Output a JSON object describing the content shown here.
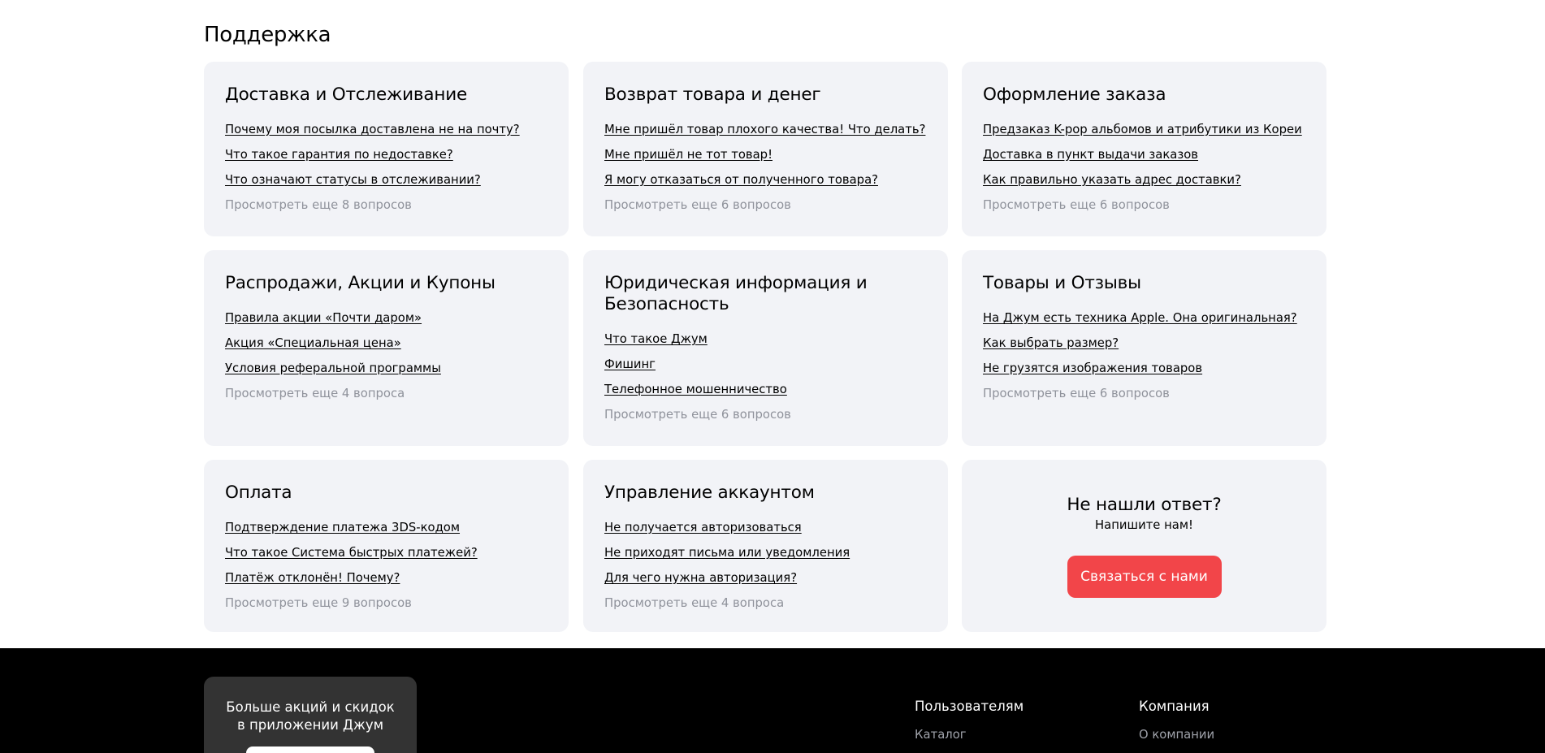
{
  "support": {
    "title": "Поддержка",
    "cards": [
      {
        "title": "Доставка и Отслеживание",
        "links": [
          "Почему моя посылка доставлена не на почту?",
          "Что такое гарантия по недоставке?",
          "Что означают статусы в отслеживании?"
        ],
        "more": "Просмотреть еще 8 вопросов"
      },
      {
        "title": "Возврат товара и денег",
        "links": [
          "Мне пришёл товар плохого качества! Что делать?",
          "Мне пришёл не тот товар!",
          "Я могу отказаться от полученного товара?"
        ],
        "more": "Просмотреть еще 6 вопросов"
      },
      {
        "title": "Оформление заказа",
        "links": [
          "Предзаказ K-pop альбомов и атрибутики из Кореи",
          "Доставка в пункт выдачи заказов",
          "Как правильно указать адрес доставки?"
        ],
        "more": "Просмотреть еще 6 вопросов"
      },
      {
        "title": "Распродажи, Акции и Купоны",
        "links": [
          "Правила акции «Почти даром»",
          "Акция «Специальная цена»",
          "Условия реферальной программы"
        ],
        "more": "Просмотреть еще 4 вопроса"
      },
      {
        "title": "Юридическая информация и Безопасность",
        "links": [
          "Что такое Джум",
          "Фишинг",
          "Телефонное мошенничество"
        ],
        "more": "Просмотреть еще 6 вопросов"
      },
      {
        "title": "Товары и Отзывы",
        "links": [
          "На Джум есть техника Apple. Она оригинальная?",
          "Как выбрать размер?",
          "Не грузятся изображения товаров"
        ],
        "more": "Просмотреть еще 6 вопросов"
      },
      {
        "title": "Оплата",
        "links": [
          "Подтверждение платежа 3DS-кодом",
          "Что такое Система быстрых платежей?",
          "Платёж отклонён! Почему?"
        ],
        "more": "Просмотреть еще 9 вопросов"
      },
      {
        "title": "Управление аккаунтом",
        "links": [
          "Не получается авторизоваться",
          "Не приходят письма или уведомления",
          "Для чего нужна авторизация?"
        ],
        "more": "Просмотреть еще 4 вопроса"
      }
    ],
    "contact": {
      "title": "Не нашли ответ?",
      "subtitle": "Напишите нам!",
      "button": "Связаться с нами",
      "button_color": "#f24549"
    }
  },
  "footer": {
    "promo_line1": "Больше акций и скидок",
    "promo_line2": "в приложении Джум",
    "columns": [
      {
        "title": "Пользователям",
        "links": [
          "Каталог"
        ]
      },
      {
        "title": "Компания",
        "links": [
          "О компании"
        ]
      }
    ]
  }
}
